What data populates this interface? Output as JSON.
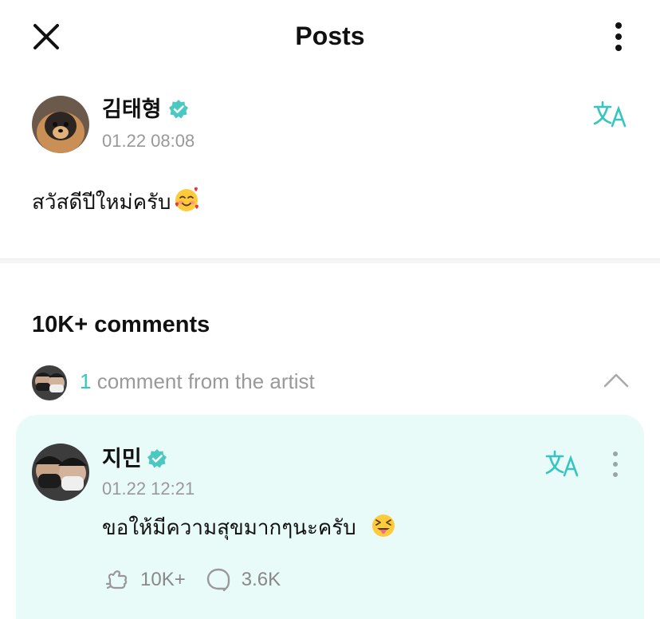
{
  "header": {
    "title": "Posts",
    "close_icon": "close-icon",
    "more_icon": "more-vertical-icon"
  },
  "post": {
    "author": "김태형",
    "verified_icon": "verified-badge-icon",
    "time": "01.22 08:08",
    "translate_icon": "translate-icon",
    "text": "สวัสดีปีใหม่ครับ",
    "emoji": "smiling-face-with-hearts-emoji"
  },
  "comments": {
    "heading": "10K+ comments",
    "artist_count": "1",
    "artist_label": " comment from the artist",
    "toggle_icon": "chevron-up-icon"
  },
  "comment": {
    "author": "지민",
    "time": "01.22 12:21",
    "text": "ขอให้มีความสุขมากๆนะครับ",
    "emoji": "squinting-face-with-tongue-emoji",
    "likes": "10K+",
    "replies": "3.6K"
  },
  "colors": {
    "accent": "#36c5c1",
    "card_background": "#e9fbf9",
    "muted_text": "#999999"
  }
}
